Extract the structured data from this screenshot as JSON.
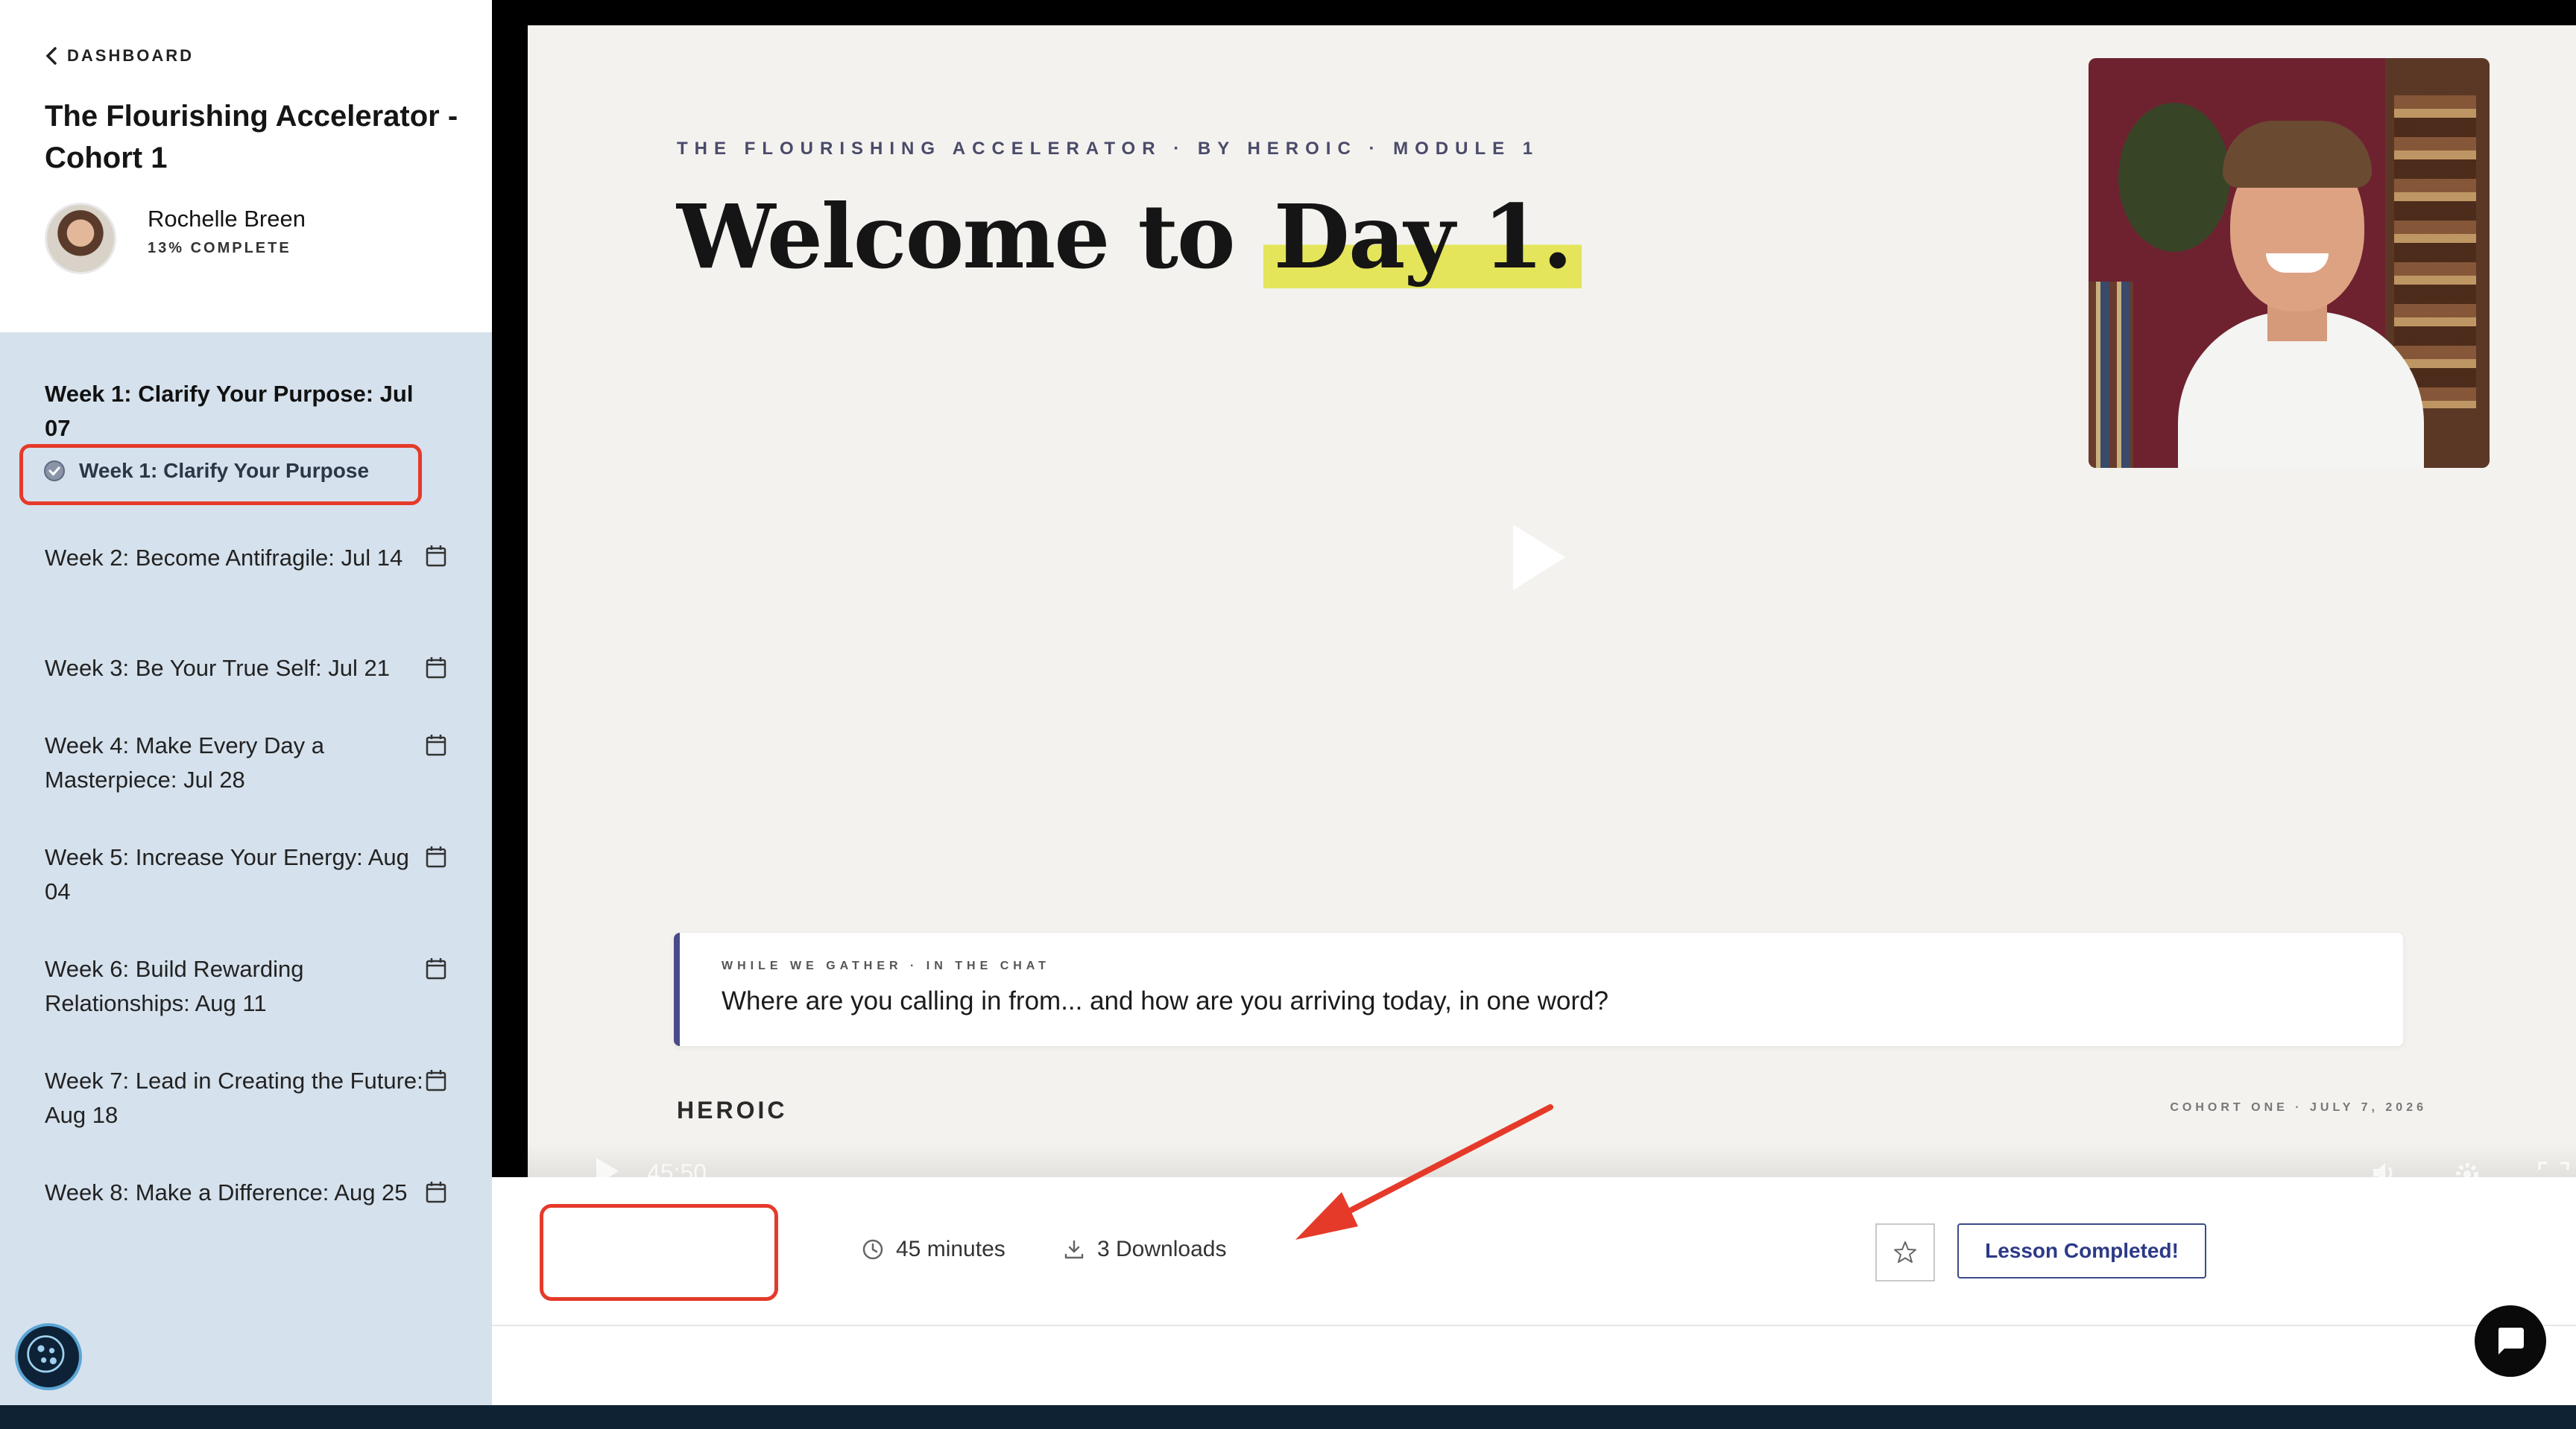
{
  "sidebar": {
    "back_label": "DASHBOARD",
    "course_title": "The Flourishing Accelerator - Cohort 1",
    "user": {
      "name": "Rochelle Breen",
      "progress_label": "13% COMPLETE"
    },
    "weeks": [
      {
        "label": "Week 1: Clarify Your Purpose: Jul 07",
        "state": "active"
      },
      {
        "label": "Week 2: Become Antifragile: Jul 14",
        "state": "scheduled",
        "icon": "calendar-icon"
      },
      {
        "label": "Week 3: Be Your True Self: Jul 21",
        "state": "scheduled",
        "icon": "calendar-icon"
      },
      {
        "label": "Week 4: Make Every Day a Masterpiece: Jul 28",
        "state": "scheduled",
        "icon": "calendar-icon"
      },
      {
        "label": "Week 5: Increase Your Energy: Aug 04",
        "state": "scheduled",
        "icon": "calendar-icon"
      },
      {
        "label": "Week 6: Build Rewarding Relationships: Aug 11",
        "state": "scheduled",
        "icon": "calendar-icon"
      },
      {
        "label": "Week 7: Lead in Creating the Future: Aug 18",
        "state": "scheduled",
        "icon": "calendar-icon"
      },
      {
        "label": "Week 8: Make a Difference: Aug 25",
        "state": "scheduled",
        "icon": "calendar-icon"
      }
    ],
    "active_lesson": {
      "label": "Week 1: Clarify Your Purpose",
      "icon": "check-circle-icon"
    }
  },
  "video": {
    "slide_eyebrow": "THE FLOURISHING ACCELERATOR · BY HEROIC · MODULE 1",
    "slide_title_prefix": "Welcome to",
    "slide_title_highlight": "Day 1.",
    "chat_card_eyebrow": "WHILE WE GATHER · IN THE CHAT",
    "chat_card_question": "Where are you calling in from... and how are you arriving today, in one word?",
    "brand_logo": "HEROIC",
    "footer_right": "COHORT ONE · JULY 7, 2026",
    "controls": {
      "time": "45:50"
    }
  },
  "lesson_meta": {
    "duration": "45 minutes",
    "downloads": "3 Downloads",
    "complete_button": "Lesson Completed!"
  },
  "colors": {
    "sidebar_bg": "#d5e1ec",
    "annotation": "#e53a2a",
    "complete_accent": "#2c3a86",
    "highlight": "#e4e55a"
  }
}
